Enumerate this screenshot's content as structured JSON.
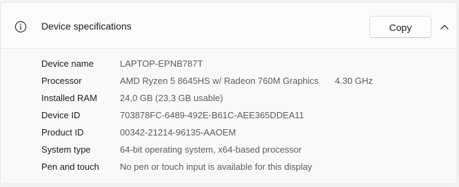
{
  "header": {
    "title": "Device specifications",
    "info_icon": "info-icon",
    "copy_label": "Copy",
    "collapse_icon": "chevron-up-icon"
  },
  "specs": [
    {
      "label": "Device name",
      "value": "LAPTOP-EPNB787T",
      "extra": ""
    },
    {
      "label": "Processor",
      "value": "AMD Ryzen 5 8645HS w/ Radeon 760M Graphics",
      "extra": "4.30 GHz"
    },
    {
      "label": "Installed RAM",
      "value": "24,0 GB (23,3 GB usable)",
      "extra": ""
    },
    {
      "label": "Device ID",
      "value": "703878FC-6489-492E-B61C-AEE365DDEA11",
      "extra": ""
    },
    {
      "label": "Product ID",
      "value": "00342-21214-96135-AAOEM",
      "extra": ""
    },
    {
      "label": "System type",
      "value": "64-bit operating system, x64-based processor",
      "extra": ""
    },
    {
      "label": "Pen and touch",
      "value": "No pen or touch input is available for this display",
      "extra": ""
    }
  ]
}
